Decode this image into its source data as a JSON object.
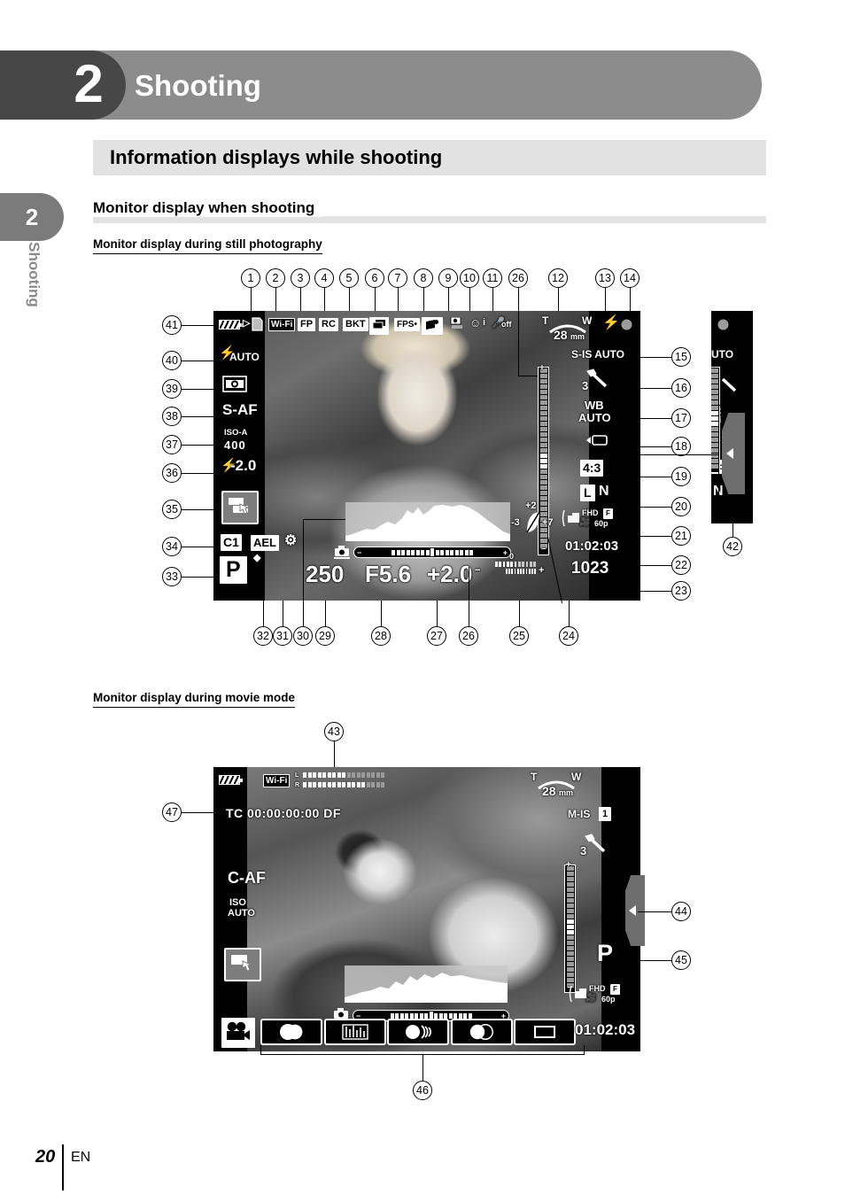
{
  "chapter": {
    "number": "2",
    "title": "Shooting"
  },
  "section": {
    "title": "Information displays while shooting"
  },
  "subsection": {
    "title": "Monitor display when shooting"
  },
  "captions": {
    "still": "Monitor display during still photography",
    "movie": "Monitor display during movie mode"
  },
  "margin_tab": {
    "number": "2",
    "label": "Shooting"
  },
  "footer": {
    "page": "20",
    "language": "EN"
  },
  "still_display": {
    "top_icons": [
      {
        "id": "card-icon",
        "label": ""
      },
      {
        "id": "wifi-badge",
        "label": "Wi-Fi"
      },
      {
        "id": "fp-badge",
        "label": "FP"
      },
      {
        "id": "rc-badge",
        "label": "RC"
      },
      {
        "id": "bkt-badge",
        "label": "BKT"
      },
      {
        "id": "multi-exposure-icon",
        "label": ""
      },
      {
        "id": "fps-badge",
        "label": "FPS"
      },
      {
        "id": "keystone-icon",
        "label": ""
      },
      {
        "id": "hdr-icon",
        "label": ""
      },
      {
        "id": "face-priority-icon",
        "label": ""
      },
      {
        "id": "mic-off-icon",
        "label": "off"
      }
    ],
    "left_column": {
      "flash_mode": "AUTO",
      "metering_mode": "spot-metering-icon",
      "af_mode": "S-AF",
      "iso_label": "ISO-A",
      "iso_value": "400",
      "flash_comp": "-2.0",
      "touch_icon": "touch-shutter-icon",
      "custom_mode": "C1",
      "ael": "AEL",
      "sequential_icon": "sequential-drive-icon",
      "shoot_mode": "P"
    },
    "right_column": {
      "zoom_tele": "T",
      "zoom_wide": "W",
      "focal_length": "28",
      "focal_unit": "mm",
      "flash_ready_icon": "flash-bolt-icon",
      "record_dot_icon": "record-dot-icon",
      "image_stab": "S-IS AUTO",
      "art_filter_number": "3",
      "wb_label": "WB",
      "wb_value": "AUTO",
      "battery_small_icon": "battery-icon",
      "aspect_ratio": "4:3",
      "image_size": "L",
      "image_quality": "N",
      "movie_quality_top": "FHD",
      "movie_quality_f": "F",
      "movie_fps": "60p",
      "record_time": "01:02:03",
      "shots_remaining": "1023"
    },
    "bottom_row": {
      "shutter_speed": "250",
      "aperture": "F5.6",
      "exposure_comp": "+2.0",
      "meter_zero": "0",
      "highlight_shadow_top": "+2",
      "highlight_shadow_left": "-3",
      "highlight_shadow_right": "+7"
    },
    "callouts": [
      "1",
      "2",
      "3",
      "4",
      "5",
      "6",
      "7",
      "8",
      "9",
      "10",
      "11",
      "12",
      "13",
      "14",
      "15",
      "16",
      "17",
      "18",
      "19",
      "20",
      "21",
      "22",
      "23",
      "24",
      "25",
      "26",
      "27",
      "28",
      "29",
      "30",
      "31",
      "32",
      "33",
      "34",
      "35",
      "36",
      "37",
      "38",
      "39",
      "40",
      "41",
      "42"
    ]
  },
  "movie_display": {
    "wifi_badge": "Wi-Fi",
    "level_meter_l": "L",
    "level_meter_r": "R",
    "timecode": "TC 00:00:00:00 DF",
    "af_mode": "C-AF",
    "iso_label": "ISO",
    "iso_value": "AUTO",
    "touch_icon": "touch-shutter-icon",
    "zoom_tele": "T",
    "zoom_wide": "W",
    "focal_length": "28",
    "focal_unit": "mm",
    "image_stab": "M-IS",
    "image_stab_value": "1",
    "art_filter_number": "3",
    "shoot_mode": "P",
    "movie_quality_top": "FHD",
    "movie_quality_f": "F",
    "movie_fps": "60p",
    "record_time": "01:02:03",
    "movie_icon": "movie-camera-icon",
    "effect_buttons": [
      {
        "id": "art-fade-button",
        "label": ""
      },
      {
        "id": "movie-teleconverter-button",
        "label": ""
      },
      {
        "id": "echo-button",
        "label": ""
      },
      {
        "id": "multi-echo-button",
        "label": ""
      },
      {
        "id": "off-button",
        "label": ""
      }
    ],
    "callouts": [
      "43",
      "44",
      "45",
      "46",
      "47"
    ]
  },
  "colors": {
    "chapter_band": "#8c8c8c",
    "chapter_tab": "#474747",
    "section_bar": "#e2e2e2",
    "margin_tab": "#7b7b7b",
    "monitor_bg": "#000000"
  }
}
